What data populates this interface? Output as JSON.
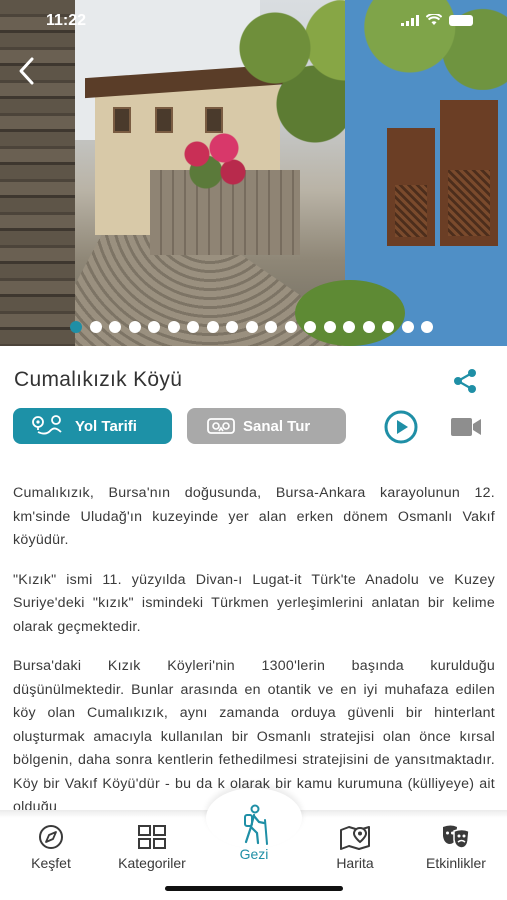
{
  "status": {
    "time": "11:22"
  },
  "gallery": {
    "dot_count": 19,
    "active_index": 0
  },
  "place": {
    "title": "Cumalıkızık Köyü"
  },
  "actions": {
    "route_label": "Yol Tarifi",
    "tour_label": "Sanal Tur"
  },
  "content": {
    "paragraphs": [
      "Cumalıkızık, Bursa'nın doğusunda, Bursa-Ankara karayolunun 12. km'sinde Uludağ'ın kuzeyinde yer alan erken dönem Osmanlı Vakıf köyüdür.",
      " \"Kızık\" ismi 11. yüzyılda Divan-ı Lugat-it Türk'te Anadolu ve Kuzey Suriye'deki \"kızık\" ismindeki Türkmen yerleşimlerini anlatan bir kelime olarak geçmektedir.",
      "Bursa'daki Kızık Köyleri'nin 1300'lerin başında kurulduğu düşünülmektedir. Bunlar arasında en otantik ve en iyi muhafaza edilen köy olan Cumalıkızık, aynı zamanda orduya güvenli bir hinterlant oluşturmak amacıyla kullanılan bir Osmanlı stratejisi olan önce kırsal bölgenin, daha sonra kentlerin fethedilmesi stratejisini de yansıtmaktadır. Köy bir Vakıf Köyü'dür - bu da k olarak bir kamu kurumuna (külliyeye) ait olduğu"
    ]
  },
  "tabs": [
    {
      "label": "Keşfet",
      "icon": "compass-icon"
    },
    {
      "label": "Kategoriler",
      "icon": "grid-icon"
    },
    {
      "label": "Gezi",
      "icon": "hiker-icon"
    },
    {
      "label": "Harita",
      "icon": "map-pin-icon"
    },
    {
      "label": "Etkinlikler",
      "icon": "theater-masks-icon"
    }
  ],
  "active_tab": "Gezi",
  "colors": {
    "accent": "#1d91a7",
    "secondary_button": "#a9a9a9"
  }
}
